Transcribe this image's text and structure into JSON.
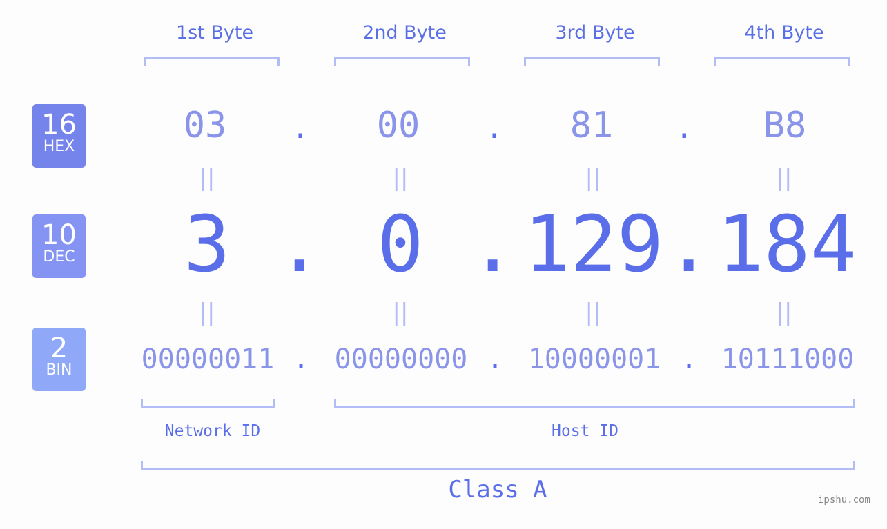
{
  "badges": [
    {
      "num": "16",
      "label": "HEX",
      "color": "#7584ea"
    },
    {
      "num": "10",
      "label": "DEC",
      "color": "#8593f2"
    },
    {
      "num": "2",
      "label": "BIN",
      "color": "#8fa8f8"
    }
  ],
  "bytes": [
    {
      "label": "1st Byte",
      "hex": "03",
      "dec": "3",
      "bin": "00000011"
    },
    {
      "label": "2nd Byte",
      "hex": "00",
      "dec": "0",
      "bin": "00000000"
    },
    {
      "label": "3rd Byte",
      "hex": "81",
      "dec": "129",
      "bin": "10000001"
    },
    {
      "label": "4th Byte",
      "hex": "B8",
      "dec": "184",
      "bin": "10111000"
    }
  ],
  "separator": ".",
  "equals": "||",
  "network_id_label": "Network ID",
  "host_id_label": "Host ID",
  "class_label": "Class A",
  "watermark": "ipshu.com",
  "colors": {
    "accent": "#5a6eea",
    "light": "#8a95ea",
    "bracket": "#b3bdf5"
  }
}
